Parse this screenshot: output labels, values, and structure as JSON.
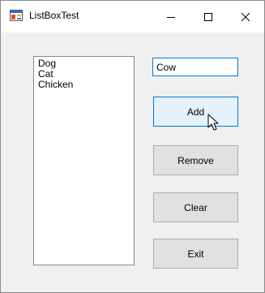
{
  "window": {
    "title": "ListBoxTest",
    "icon": "winforms-app-icon",
    "controls": [
      "minimize-icon",
      "maximize-icon",
      "close-icon"
    ]
  },
  "listbox": {
    "items": [
      "Dog",
      "Cat",
      "Chicken"
    ]
  },
  "textbox": {
    "value": "Cow"
  },
  "buttons": {
    "add": "Add",
    "remove": "Remove",
    "clear": "Clear",
    "exit": "Exit"
  },
  "colors": {
    "accent": "#0078d7",
    "window_bg": "#f0f0f0",
    "button_bg": "#e1e1e1",
    "button_hover_bg": "#e5f1fb"
  },
  "cursor": "arrow-pointer"
}
